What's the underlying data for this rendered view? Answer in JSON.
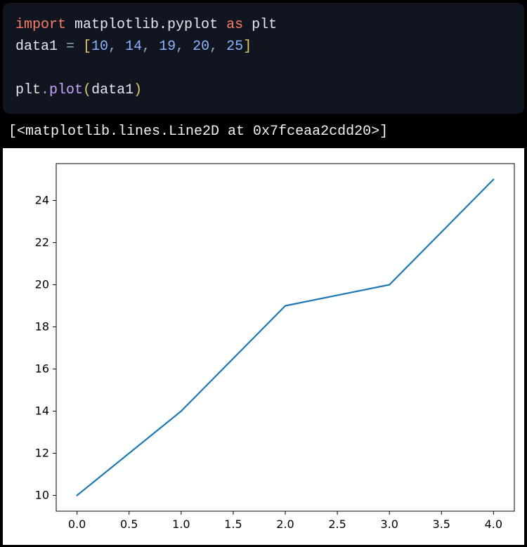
{
  "code": {
    "line1": {
      "kw_import": "import",
      "module": "matplotlib.pyplot",
      "kw_as": "as",
      "alias": "plt"
    },
    "line2": {
      "varname": "data1",
      "eq": " = ",
      "lb": "[",
      "n0": "10",
      "c0": ", ",
      "n1": "14",
      "c1": ", ",
      "n2": "19",
      "c2": ", ",
      "n3": "20",
      "c3": ", ",
      "n4": "25",
      "rb": "]"
    },
    "line3": {
      "obj": "plt",
      "dot": ".",
      "method": "plot",
      "lp": "(",
      "arg": "data1",
      "rp": ")"
    }
  },
  "output_repr": "[<matplotlib.lines.Line2D at 0x7fceaa2cdd20>]",
  "chart_data": {
    "type": "line",
    "x": [
      0,
      1,
      2,
      3,
      4
    ],
    "values": [
      10,
      14,
      19,
      20,
      25
    ],
    "title": "",
    "xlabel": "",
    "ylabel": "",
    "xticks": [
      "0.0",
      "0.5",
      "1.0",
      "1.5",
      "2.0",
      "2.5",
      "3.0",
      "3.5",
      "4.0"
    ],
    "xtick_vals": [
      0,
      0.5,
      1,
      1.5,
      2,
      2.5,
      3,
      3.5,
      4
    ],
    "yticks": [
      "10",
      "12",
      "14",
      "16",
      "18",
      "20",
      "22",
      "24"
    ],
    "ytick_vals": [
      10,
      12,
      14,
      16,
      18,
      20,
      22,
      24
    ],
    "xlim": [
      -0.2,
      4.2
    ],
    "ylim": [
      9.25,
      25.75
    ],
    "line_color": "#1f77b4"
  }
}
